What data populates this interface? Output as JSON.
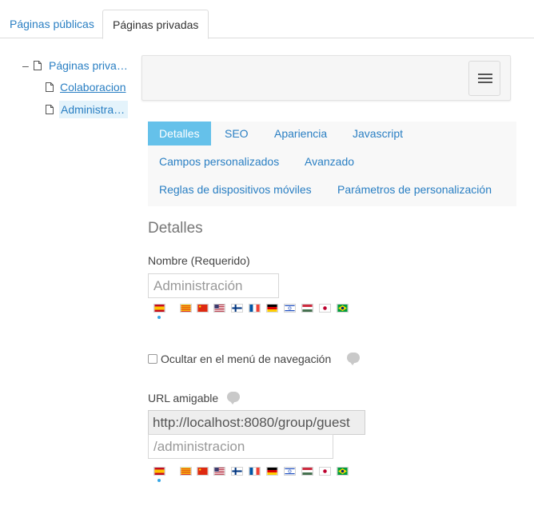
{
  "top_tabs": {
    "public_label": "Páginas públicas",
    "private_label": "Páginas privadas"
  },
  "tree": {
    "root_toggle": "–",
    "root_label": "Páginas priva…",
    "children": [
      {
        "label": "Colaboracion"
      },
      {
        "label": "Administra…"
      }
    ]
  },
  "subtabs": [
    {
      "label": "Detalles",
      "active": true
    },
    {
      "label": "SEO"
    },
    {
      "label": "Apariencia"
    },
    {
      "label": "Javascript"
    },
    {
      "label": "Campos personalizados"
    },
    {
      "label": "Avanzado"
    },
    {
      "label": "Reglas de dispositivos móviles"
    },
    {
      "label": "Parámetros de personalización"
    }
  ],
  "details": {
    "section_title": "Detalles",
    "name_label": "Nombre (Requerido)",
    "name_value": "Administración",
    "hide_nav_label": "Ocultar en el menú de navegación",
    "friendly_url_label": "URL amigable",
    "url_prefix": "http://localhost:8080/group/guest",
    "url_value": "/administracion"
  },
  "language_flags": [
    "es-ES",
    "ca-ES",
    "zh-CN",
    "en-US",
    "fi-FI",
    "fr-FR",
    "de-DE",
    "iw-IL",
    "hu-HU",
    "ja-JP",
    "pt-BR"
  ],
  "colors": {
    "link": "#2a7fc3",
    "active_tab_bg": "#65c1ea",
    "selected_tree_bg": "#e4f3fb"
  }
}
